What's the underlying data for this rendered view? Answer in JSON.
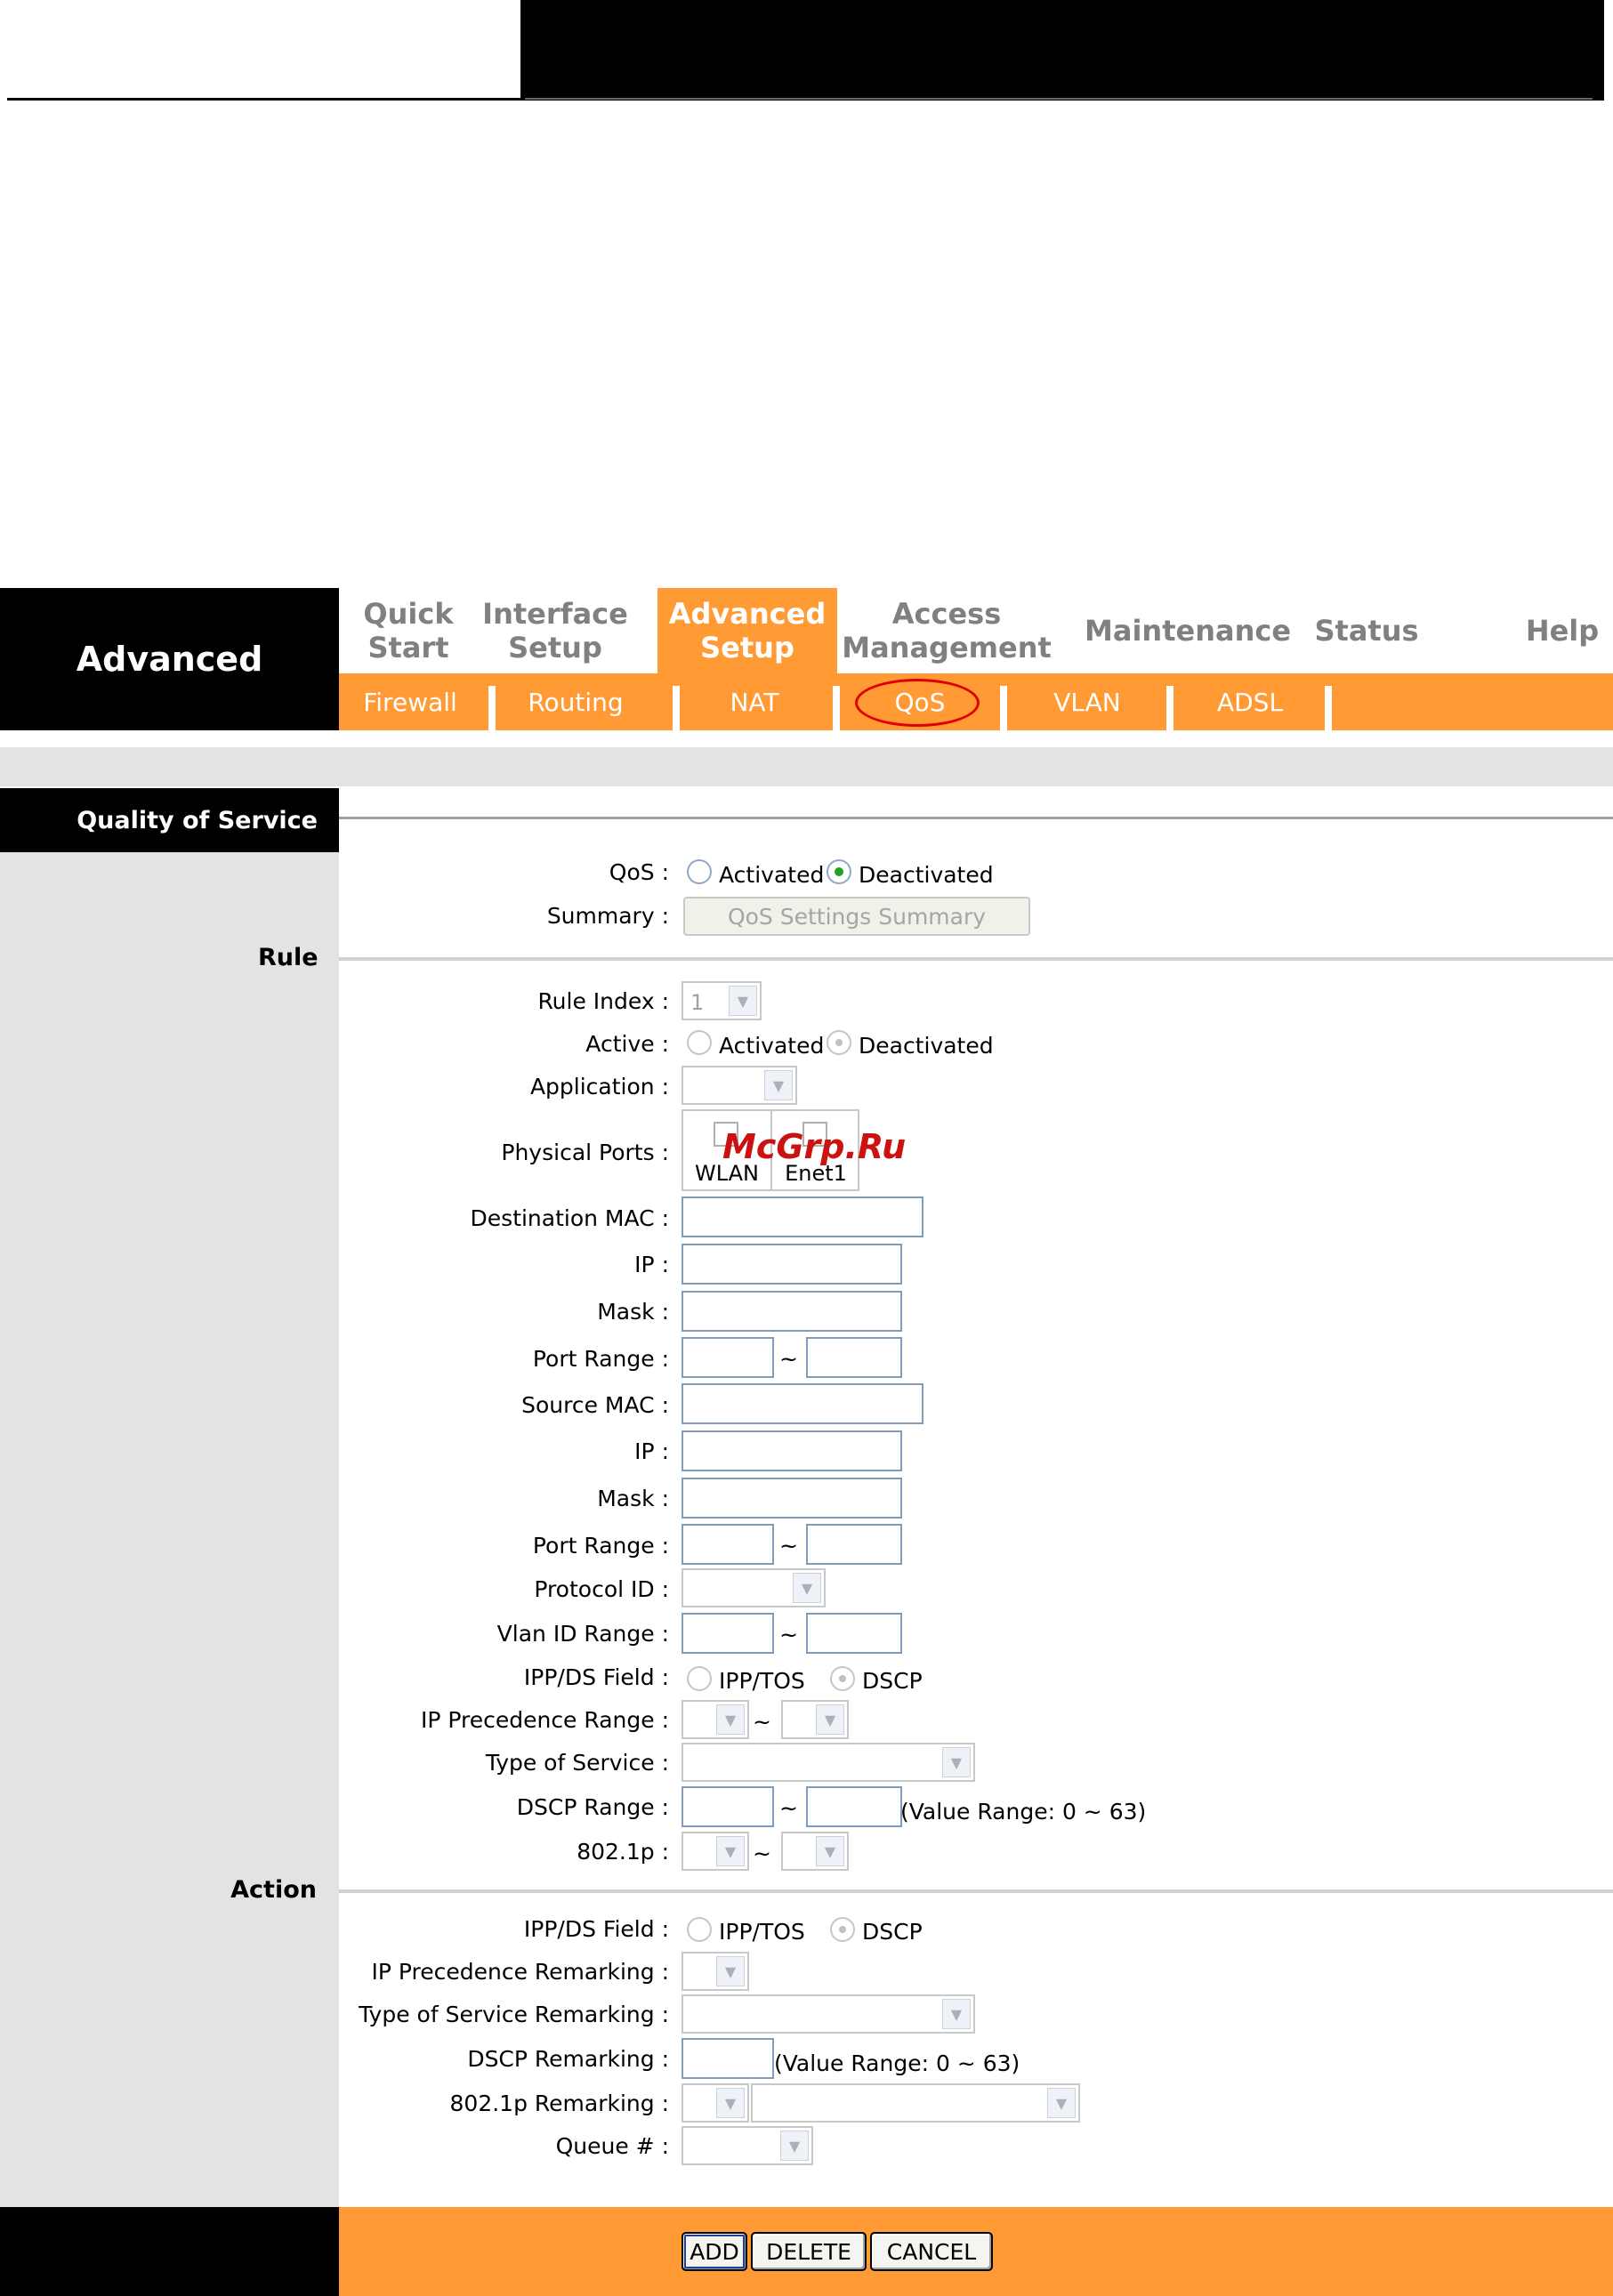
{
  "brand": "Advanced",
  "main_nav": [
    {
      "label": "Quick\nStart"
    },
    {
      "label": "Interface\nSetup"
    },
    {
      "label": "Advanced\nSetup",
      "active": true
    },
    {
      "label": "Access\nManagement"
    },
    {
      "label": "Maintenance"
    },
    {
      "label": "Status"
    },
    {
      "label": "Help"
    }
  ],
  "sub_nav": [
    "Firewall",
    "Routing",
    "NAT",
    "QoS",
    "VLAN",
    "ADSL"
  ],
  "sub_nav_active": "QoS",
  "page_title": "Quality of Service",
  "qos": {
    "label": "QoS :",
    "activated": "Activated",
    "deactivated": "Deactivated",
    "selected": "Deactivated",
    "summary_label": "Summary :",
    "summary_button": "QoS Settings Summary"
  },
  "rule": {
    "section": "Rule",
    "rule_index_label": "Rule Index :",
    "rule_index_value": "1",
    "active_label": "Active :",
    "active_on": "Activated",
    "active_off": "Deactivated",
    "application_label": "Application :",
    "physical_ports_label": "Physical Ports :",
    "ports": [
      "WLAN",
      "Enet1"
    ],
    "dest_mac_label": "Destination MAC :",
    "dest_ip_label": "IP :",
    "dest_mask_label": "Mask :",
    "dest_port_label": "Port Range :",
    "src_mac_label": "Source MAC :",
    "src_ip_label": "IP :",
    "src_mask_label": "Mask :",
    "src_port_label": "Port Range :",
    "protocol_label": "Protocol ID :",
    "vlan_label": "Vlan ID Range :",
    "ippds_label": "IPP/DS Field :",
    "ipptos": "IPP/TOS",
    "dscp": "DSCP",
    "ipprec_label": "IP Precedence Range :",
    "tos_label": "Type of Service :",
    "dscp_range_label": "DSCP Range :",
    "dscp_hint": "(Value Range: 0 ~ 63)",
    "dot1p_label": "802.1p :",
    "tilde": "~"
  },
  "action": {
    "section": "Action",
    "ippds_label": "IPP/DS Field :",
    "ipptos": "IPP/TOS",
    "dscp": "DSCP",
    "ipprec_label": "IP Precedence Remarking :",
    "tos_label": "Type of Service Remarking :",
    "dscp_label": "DSCP Remarking :",
    "dscp_hint": "(Value Range: 0 ~ 63)",
    "dot1p_label": "802.1p Remarking :",
    "queue_label": "Queue # :"
  },
  "buttons": {
    "add": "ADD",
    "delete": "DELETE",
    "cancel": "CANCEL"
  },
  "watermark": "McGrp.Ru",
  "colors": {
    "accent": "#ff9a35",
    "header": "#000000",
    "panel": "#e3e3e3",
    "highlight": "#e00000"
  }
}
